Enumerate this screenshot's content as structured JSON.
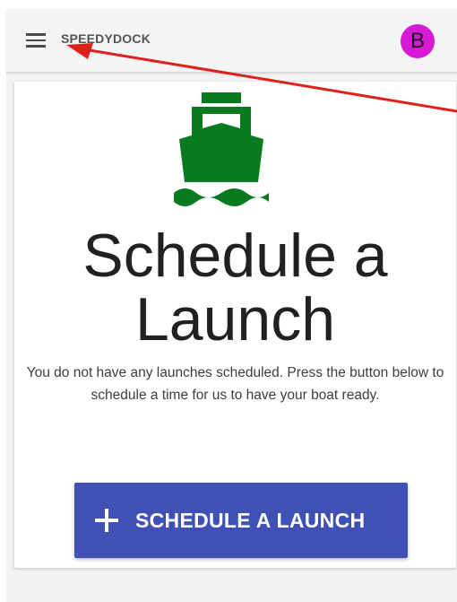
{
  "colors": {
    "accent": "#3f51b5",
    "boat_icon": "#0a7a1f",
    "avatar_bg": "#d61ad6",
    "annotation_arrow": "#e0201b"
  },
  "header": {
    "menu_icon": "hamburger-menu-icon",
    "brand": "SPEEDYDOCK",
    "avatar_letter": "B"
  },
  "card": {
    "icon": "boat-icon",
    "title_line1": "Schedule a",
    "title_line2": "Launch",
    "description": "You do not have any launches scheduled. Press the button below to schedule a time for us to have your boat ready.",
    "button": {
      "icon": "plus-icon",
      "label": "SCHEDULE A LAUNCH"
    }
  }
}
